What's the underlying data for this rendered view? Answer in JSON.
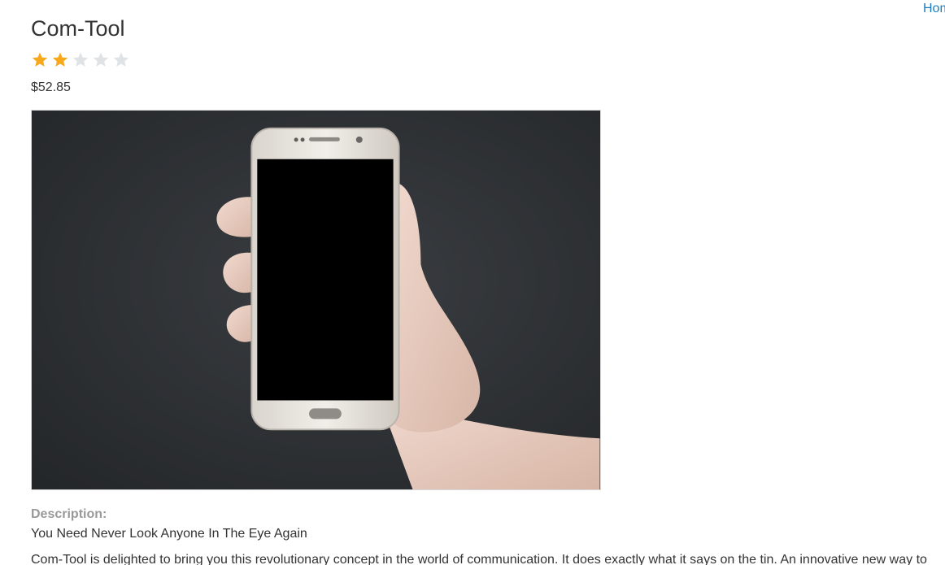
{
  "nav": {
    "home_label": "Home"
  },
  "product": {
    "title": "Com-Tool",
    "rating": 2,
    "rating_max": 5,
    "price": "$52.85",
    "image_alt": "hand holding smartphone",
    "description_label": "Description:",
    "description_subtitle": "You Need Never Look Anyone In The Eye Again",
    "description_body": "Com-Tool is delighted to bring you this revolutionary concept in the world of communication. It does exactly what it says on the tin. An innovative new way to"
  },
  "colors": {
    "star_filled": "#f7a81b",
    "star_empty": "#dfe3e6",
    "link": "#1b7ec2"
  }
}
